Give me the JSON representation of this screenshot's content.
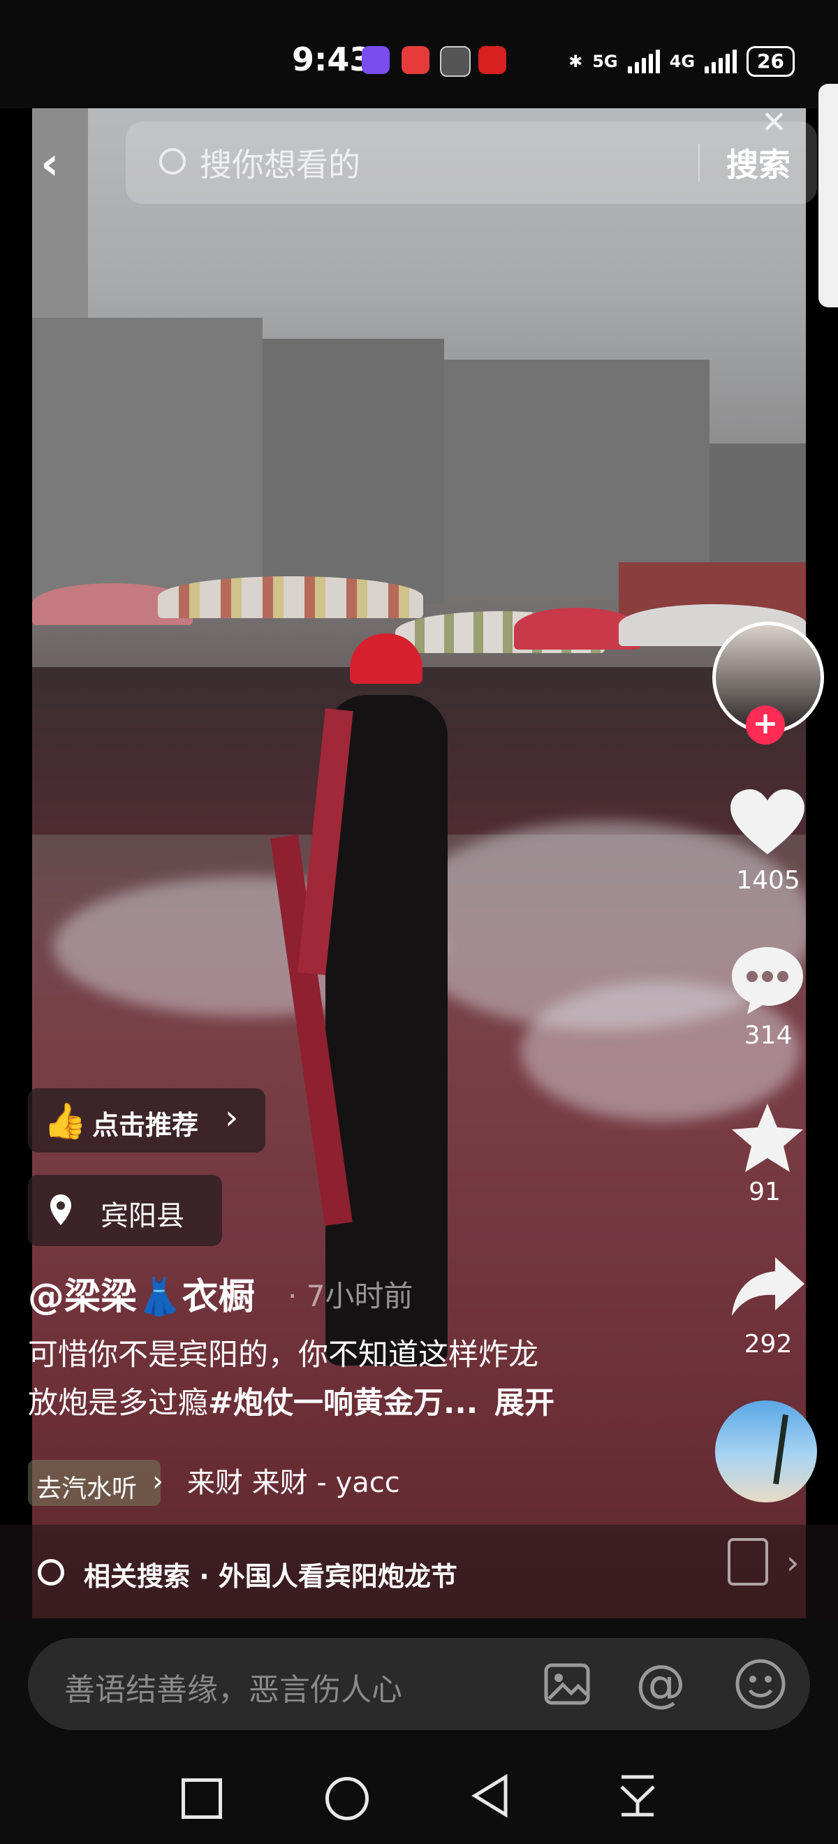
{
  "status_bar": {
    "time": "9:43",
    "network1": "5G",
    "network2": "4G",
    "battery": "26"
  },
  "search": {
    "placeholder": "搜你想看的",
    "button_label": "搜索"
  },
  "author": {
    "handle": "@梁梁👗衣橱",
    "time_ago": "· 7小时前"
  },
  "recommend_label": "点击推荐",
  "location": "宾阳县",
  "caption": {
    "line1": "可惜你不是宾阳的，你不知道这样炸龙",
    "line2_text": "放炮是多过瘾",
    "hashtag": "#炮仗一响黄金万...",
    "expand": "展开"
  },
  "music": {
    "app": "去汽水听",
    "song": "来财 来财 - yacc"
  },
  "actions": {
    "likes": "1405",
    "comments": "314",
    "favorites": "91",
    "shares": "292"
  },
  "related": {
    "label": "相关搜索 · 外国人看宾阳炮龙节"
  },
  "comment_placeholder": "善语结善缘，恶言伤人心",
  "colors": {
    "like_follow_red": "#ff2c55",
    "accent_text": "#ffffff"
  }
}
